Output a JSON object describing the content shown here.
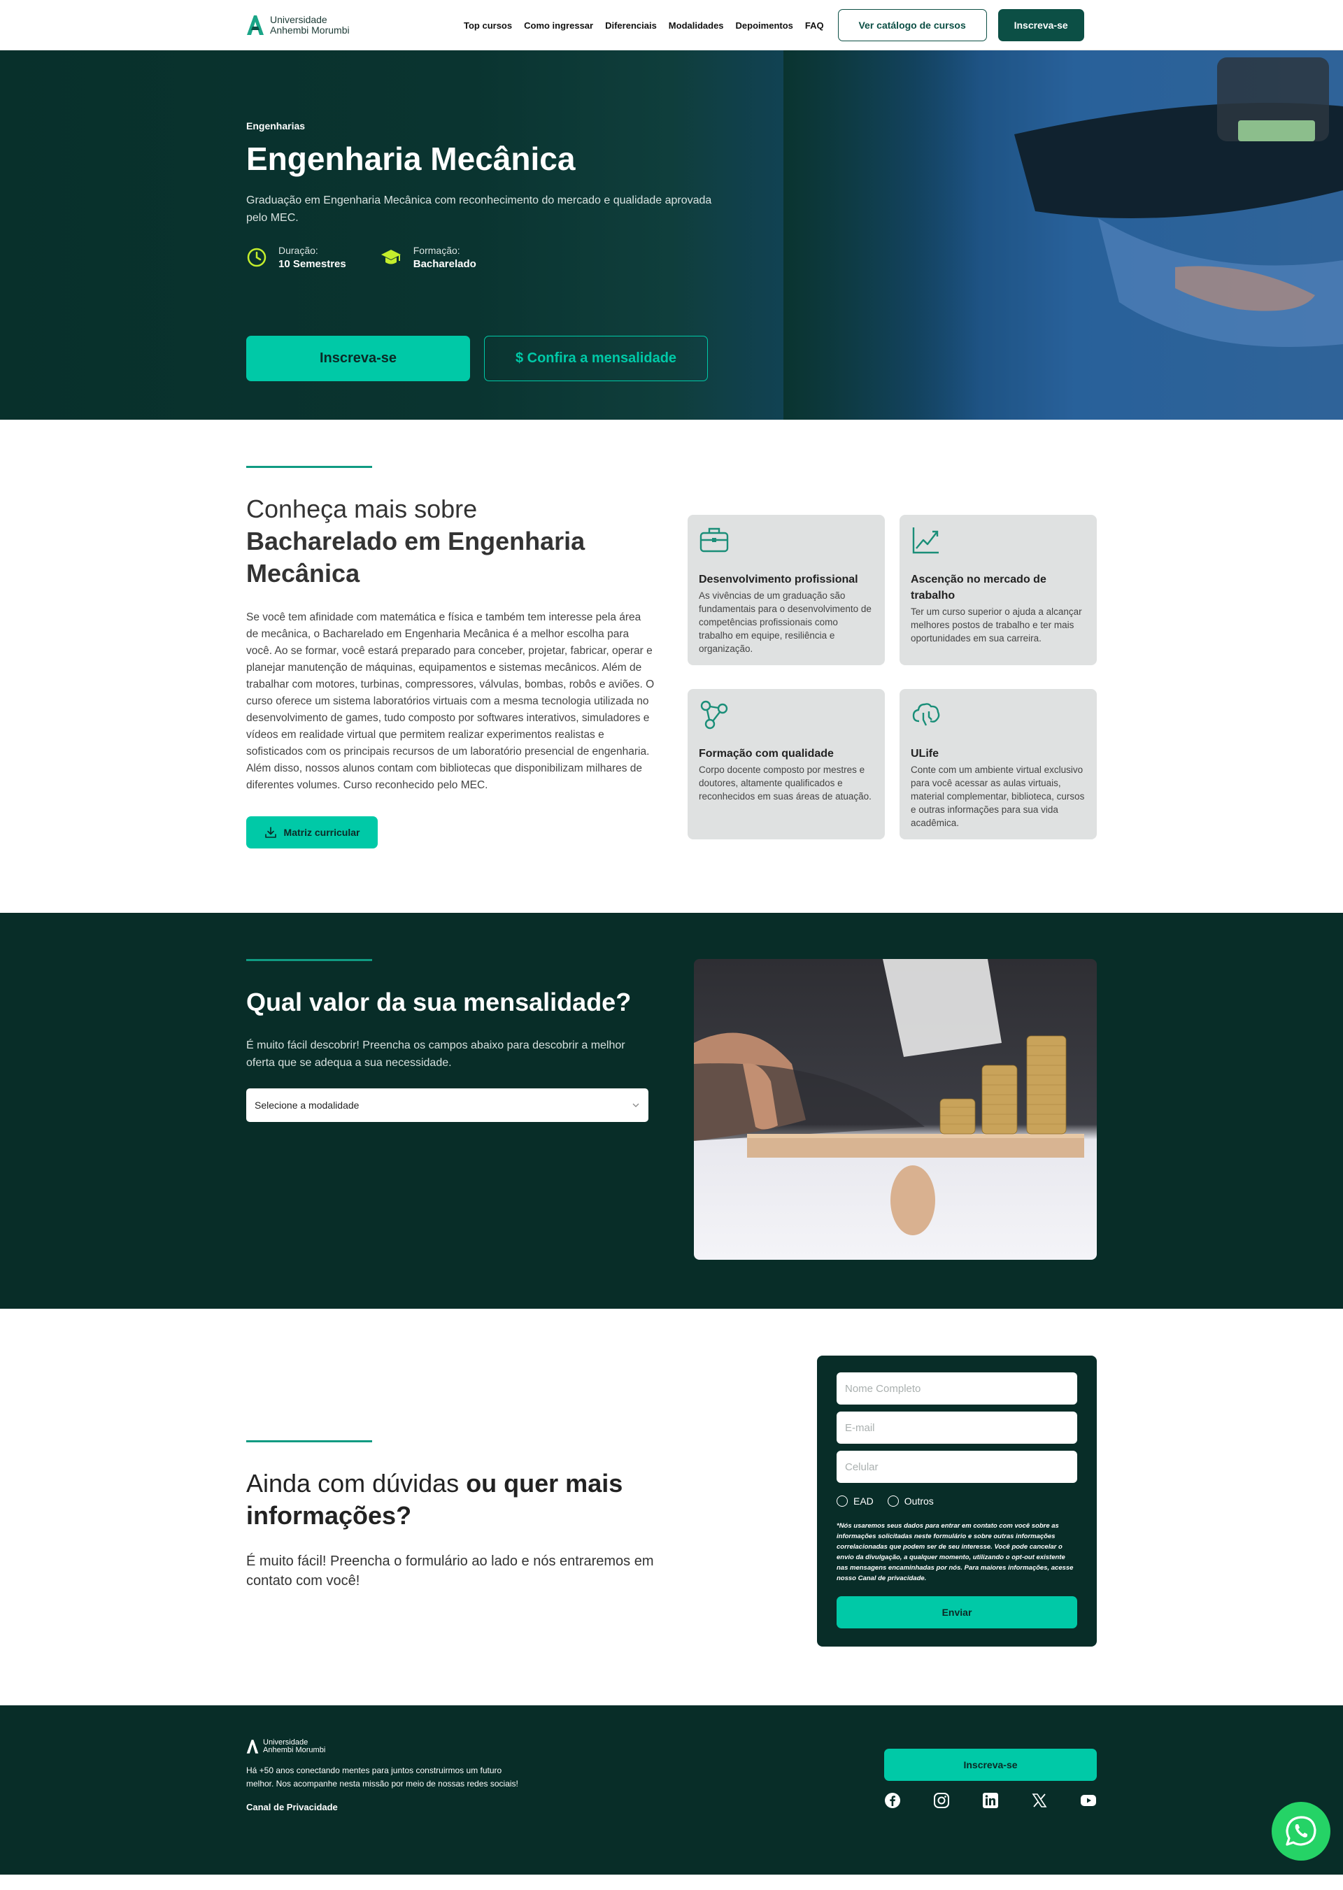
{
  "header": {
    "logo_line1": "Universidade",
    "logo_line2": "Anhembi Morumbi",
    "nav": [
      "Top cursos",
      "Como ingressar",
      "Diferenciais",
      "Modalidades",
      "Depoimentos",
      "FAQ"
    ],
    "catalog_button": "Ver catálogo de cursos",
    "enroll_button": "Inscreva-se"
  },
  "hero": {
    "crumb": "Engenharias",
    "title": "Engenharia Mecânica",
    "subtitle": "Graduação em Engenharia Mecânica com reconhecimento do mercado e qualidade aprovada pelo MEC.",
    "duration_label": "Duração:",
    "duration_value": "10 Semestres",
    "degree_label": "Formação:",
    "degree_value": "Bacharelado",
    "cta_primary": "Inscreva-se",
    "cta_secondary": "$ Confira a mensalidade"
  },
  "about": {
    "heading_light": "Conheça mais sobre",
    "heading_bold": "Bacharelado em Engenharia Mecânica",
    "description": "Se você tem afinidade com matemática e física e também tem interesse pela área de mecânica, o Bacharelado em Engenharia Mecânica é a melhor escolha para você. Ao se formar, você estará preparado para conceber, projetar, fabricar, operar e planejar manutenção de máquinas, equipamentos e sistemas mecânicos. Além de trabalhar com motores, turbinas, compressores, válvulas, bombas, robôs e aviões. O curso oferece um sistema laboratórios virtuais com a mesma tecnologia utilizada no desenvolvimento de games, tudo composto por softwares interativos, simuladores e vídeos em realidade virtual que permitem realizar experimentos realistas e sofisticados com os principais recursos de um laboratório presencial de engenharia. Além disso, nossos alunos contam com bibliotecas que disponibilizam milhares de diferentes volumes. Curso reconhecido pelo MEC.",
    "matriz_button": "Matriz curricular",
    "cards": [
      {
        "icon": "briefcase-icon",
        "title": "Desenvolvimento profissional",
        "text": "As vivências de um graduação são fundamentais para o desenvolvimento de competências profissionais como trabalho em equipe, resiliência e organização."
      },
      {
        "icon": "growth-chart-icon",
        "title": "Ascenção no mercado de trabalho",
        "text": "Ter um curso superior o ajuda a alcançar melhores postos de trabalho e ter mais oportunidades em sua carreira."
      },
      {
        "icon": "network-icon",
        "title": "Formação com qualidade",
        "text": "Corpo docente composto por mestres e doutores, altamente qualificados e reconhecidos em suas áreas de atuação."
      },
      {
        "icon": "brain-icon",
        "title": "ULife",
        "text": "Conte com um ambiente virtual exclusivo para você acessar as aulas virtuais, material complementar, biblioteca, cursos e outras informações para sua vida acadêmica."
      }
    ]
  },
  "pricing": {
    "heading": "Qual valor da sua mensalidade?",
    "description": "É muito fácil descobrir! Preencha os campos abaixo para descobrir a melhor oferta que se adequa a sua necessidade.",
    "select_value": "Selecione a modalidade"
  },
  "contact": {
    "heading_light": "Ainda com dúvidas",
    "heading_bold": "ou quer mais informações?",
    "description": "É muito fácil! Preencha o formulário ao lado e nós entraremos em contato com você!",
    "form": {
      "name_placeholder": "Nome Completo",
      "email_placeholder": "E-mail",
      "phone_placeholder": "Celular",
      "radio1": "EAD",
      "radio2": "Outros",
      "legal": "*Nós usaremos seus dados para entrar em contato com você sobre as informações solicitadas neste formulário e sobre outras informações correlacionadas que podem ser de seu interesse. Você pode cancelar o envio da divulgação, a qualquer momento, utilizando o opt-out existente nas mensagens encaminhadas por nós. Para maiores informações, acesse nosso Canal de privacidade.",
      "submit": "Enviar"
    }
  },
  "footer": {
    "logo_line1": "Universidade",
    "logo_line2": "Anhembi Morumbi",
    "text": "Há +50 anos conectando mentes para juntos construirmos um futuro melhor. Nos acompanhe nesta missão por meio de nossas redes sociais!",
    "privacy_link": "Canal de Privacidade",
    "enroll_button": "Inscreva-se"
  },
  "colors": {
    "brand_dark": "#082d28",
    "accent": "#00c9a7",
    "button_dark": "#0c4f45"
  }
}
